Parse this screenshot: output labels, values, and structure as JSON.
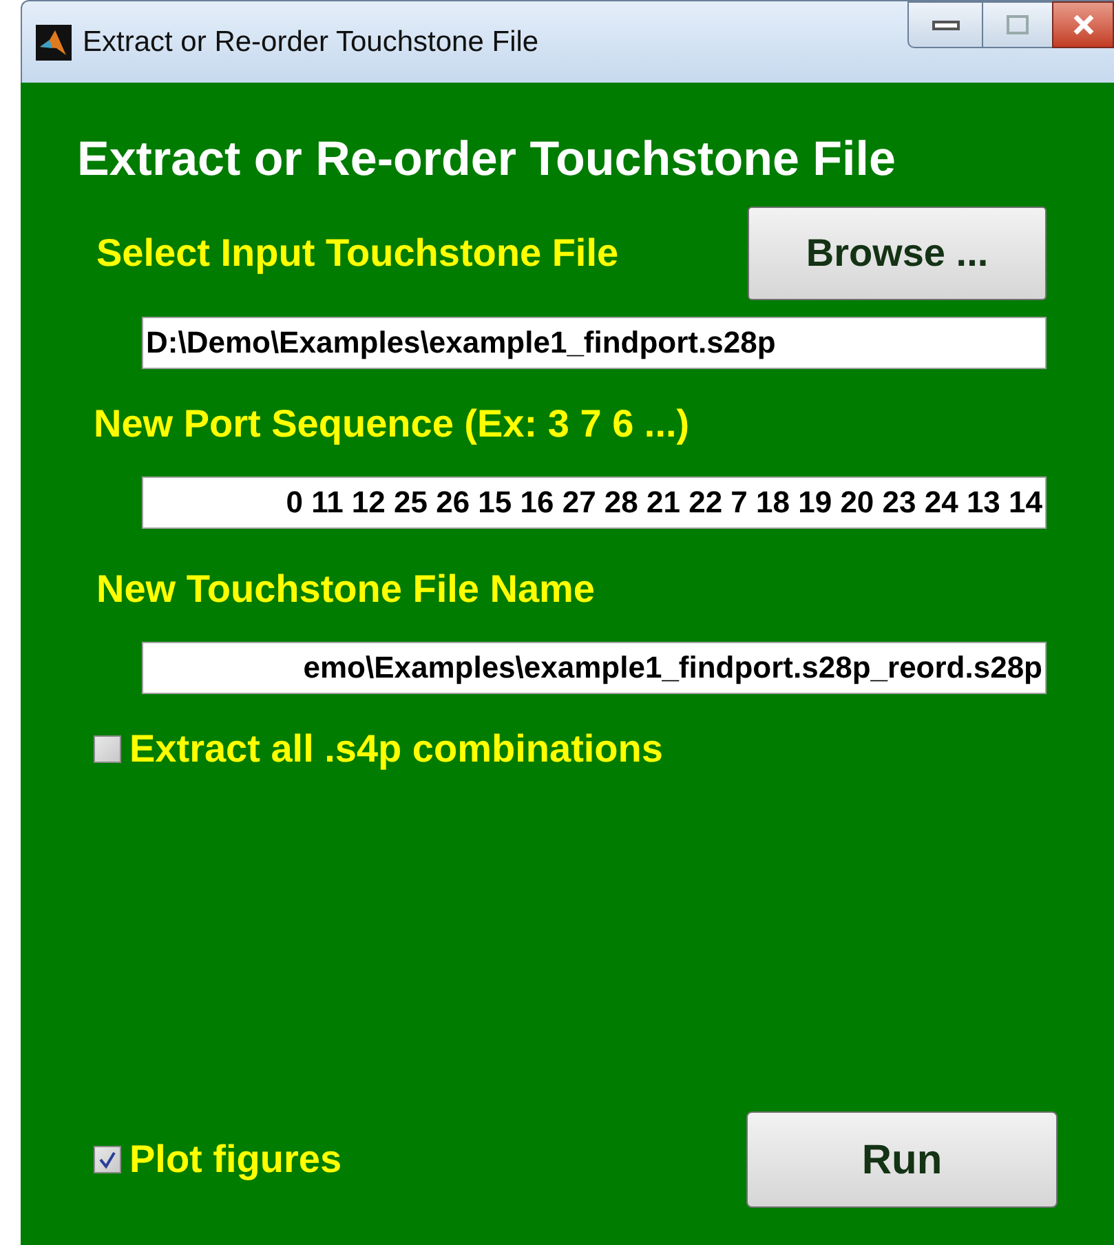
{
  "window": {
    "title": "Extract or Re-order Touchstone File"
  },
  "heading": "Extract or Re-order Touchstone File",
  "input_file": {
    "label": "Select Input Touchstone File",
    "button": "Browse ...",
    "value": "D:\\Demo\\Examples\\example1_findport.s28p"
  },
  "port_sequence": {
    "label": "New Port Sequence (Ex: 3 7 6 ...)",
    "value": "0 11 12 25 26 15 16 27 28 21 22 7 18 19 20 23 24 13 14"
  },
  "output_file": {
    "label": "New Touchstone File Name",
    "value": "emo\\Examples\\example1_findport.s28p_reord.s28p"
  },
  "extract_all": {
    "label": "Extract all .s4p combinations",
    "checked": false
  },
  "plot_figures": {
    "label": "Plot figures",
    "checked": true
  },
  "run_button": "Run"
}
